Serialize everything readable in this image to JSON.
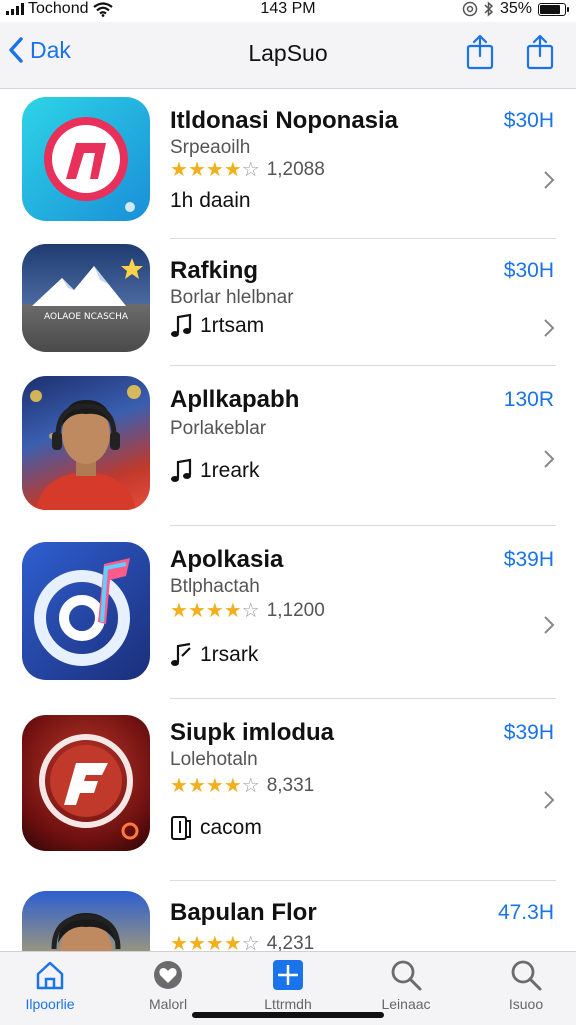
{
  "status_bar": {
    "carrier": "Tochond",
    "time": "143 PM",
    "battery_percent": "35%",
    "battery_level": 0.85
  },
  "nav": {
    "back_label": "Dak",
    "title": "LapSuo"
  },
  "apps": [
    {
      "name": "Itldonasi Noponasia",
      "subtitle": "Srpeaoilh",
      "price": "$30H",
      "rating": 3.5,
      "rating_count": "1,2088",
      "meta_icon": "none",
      "meta": "1h daain"
    },
    {
      "name": "Rafking",
      "subtitle": "Borlar hlelbnar",
      "price": "$30H",
      "meta_icon": "music-note-icon",
      "meta": "1rtsam",
      "icon_caption": "AOLAOE NCASCHA"
    },
    {
      "name": "Apllkapabh",
      "subtitle": "Porlakeblar",
      "price": "130R",
      "meta_icon": "music-note-icon",
      "meta": "1reark"
    },
    {
      "name": "Apolkasia",
      "subtitle": "Btlphactah",
      "price": "$39H",
      "rating": 4,
      "rating_count": "1,1200",
      "meta_icon": "music-note-icon",
      "meta": "1rsark"
    },
    {
      "name": "Siupk imlodua",
      "subtitle": "Lolehotaln",
      "price": "$39H",
      "rating": 3.5,
      "rating_count": "8,331",
      "meta_icon": "music-sheet-icon",
      "meta": "cacom"
    },
    {
      "name": "Bapulan Flor",
      "subtitle": "",
      "price": "47.3H",
      "rating": 3.5,
      "rating_count": "4,231",
      "meta_icon": "none",
      "meta": ""
    }
  ],
  "tabs": [
    {
      "label": "Ilpoorlie",
      "icon": "home-icon",
      "active": true
    },
    {
      "label": "Malorl",
      "icon": "heart-badge-icon",
      "active": false
    },
    {
      "label": "Lttrmdh",
      "icon": "grid-plus-icon",
      "active": false
    },
    {
      "label": "Leinaac",
      "icon": "search-icon",
      "active": false
    },
    {
      "label": "Isuoo",
      "icon": "search-icon",
      "active": false
    }
  ],
  "colors": {
    "accent": "#1a73e8",
    "star": "#f2b01e"
  }
}
